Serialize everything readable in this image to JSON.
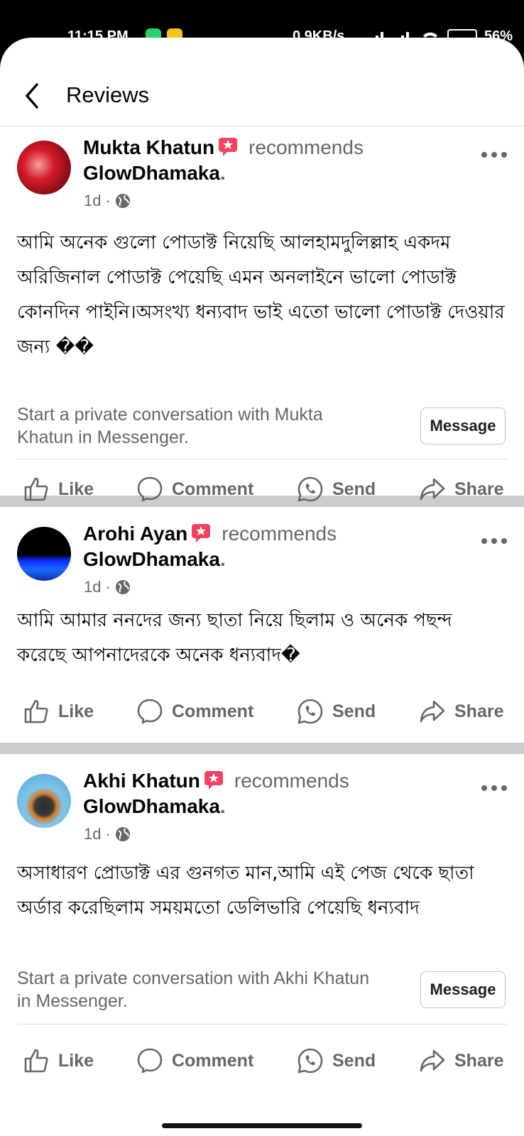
{
  "status_bar": {
    "time": "11:15 PM",
    "network_speed": "0.9KB/s",
    "battery": "56%"
  },
  "header": {
    "title": "Reviews"
  },
  "actions": {
    "like": "Like",
    "comment": "Comment",
    "send": "Send",
    "share": "Share"
  },
  "reviews": [
    {
      "author": "Mukta Khatun",
      "recommends": "recommends",
      "page": "GlowDhamaka",
      "period": ".",
      "time": "1d",
      "text": "আমি অনেক গুলো পোডাক্ট নিয়েছি আলহামদুলিল্লাহ একদম অরিজিনাল পোডাক্ট পেয়েছি এমন অনলাইনে ভালো পোডাক্ট কোনদিন পাইনি।অসংখ্য ধন্যবাদ ভাই এতো ভালো পোডাক্ট দেওয়ার জন্য ��",
      "prompt": "Start a private conversation with Mukta Khatun in Messenger.",
      "message_label": "Message"
    },
    {
      "author": "Arohi Ayan",
      "recommends": "recommends",
      "page": "GlowDhamaka",
      "period": ".",
      "time": "1d",
      "text": "আমি আমার ননদের জন্য ছাতা নিয়ে ছিলাম ও অনেক পছন্দ করেছে আপনাদেরকে অনেক ধন্যবাদ�"
    },
    {
      "author": "Akhi Khatun",
      "recommends": "recommends",
      "page": "GlowDhamaka",
      "period": ".",
      "time": "1d",
      "text": "অসাধারণ প্রোডাক্ট এর গুনগত মান,আমি এই পেজ থেকে ছাতা অর্ডার করেছিলাম সময়মতো ডেলিভারি পেয়েছি ধন্যবাদ",
      "prompt": "Start a private conversation with Akhi Khatun in Messenger.",
      "message_label": "Message"
    }
  ],
  "colors": {
    "primary_text": "#050505",
    "secondary_text": "#65676b",
    "divider": "#c9ccd1",
    "badge": "#f3425f"
  }
}
